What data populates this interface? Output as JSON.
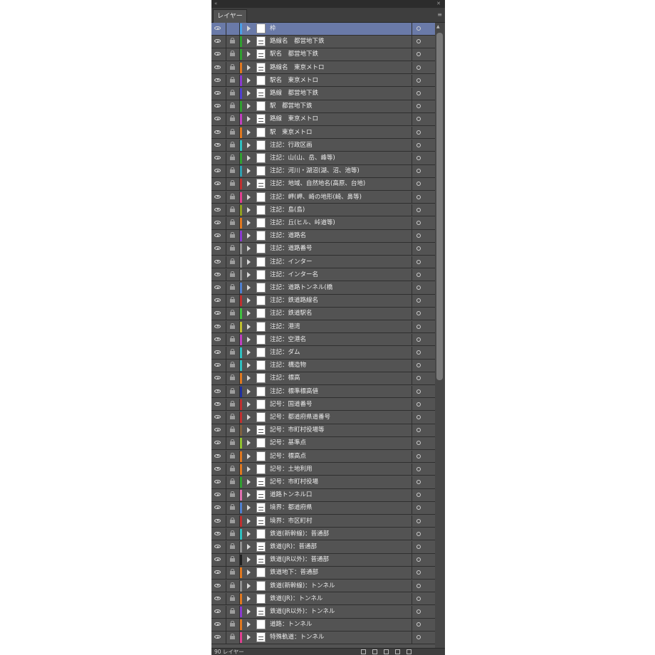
{
  "panel": {
    "tab_label": "レイヤー",
    "menu_icon": "panel-menu-icon",
    "footer_count": "90 レイヤー",
    "colors": {
      "background": "#535353",
      "selected": "#6a7aa8",
      "border": "#2f2f2f"
    }
  },
  "layers": [
    {
      "name": "枠",
      "color": "#4aa0e8",
      "locked": false,
      "selected": true,
      "thumb": "blank"
    },
    {
      "name": "路線名　都営地下鉄",
      "color": "#30a030",
      "locked": true,
      "thumb": "mark"
    },
    {
      "name": "駅名　都営地下鉄",
      "color": "#30a030",
      "locked": true,
      "thumb": "mark"
    },
    {
      "name": "路線名　東京メトロ",
      "color": "#e07820",
      "locked": true,
      "thumb": "mark"
    },
    {
      "name": "駅名　東京メトロ",
      "color": "#8a3ad0",
      "locked": true,
      "thumb": "blank"
    },
    {
      "name": "路線　都営地下鉄",
      "color": "#5040d0",
      "locked": true,
      "thumb": "mark"
    },
    {
      "name": "駅　都営地下鉄",
      "color": "#30a030",
      "locked": true,
      "thumb": "blank"
    },
    {
      "name": "路線　東京メトロ",
      "color": "#c040c0",
      "locked": true,
      "thumb": "mark"
    },
    {
      "name": "駅　東京メトロ",
      "color": "#e07820",
      "locked": true,
      "thumb": "blank"
    },
    {
      "name": "注記：行政区画",
      "color": "#30c0c0",
      "locked": true,
      "thumb": "blank"
    },
    {
      "name": "注記：山(山、岳、峰等)",
      "color": "#30a030",
      "locked": true,
      "thumb": "blank"
    },
    {
      "name": "注記：河川・湖沼(湖、沼、池等)",
      "color": "#30a0b0",
      "locked": true,
      "thumb": "blank"
    },
    {
      "name": "注記：地域、自然地名(高原、台地)",
      "color": "#c03030",
      "locked": true,
      "thumb": "mark"
    },
    {
      "name": "注記：岬(岬、崎の地形(崎、鼻等)",
      "color": "#e04090",
      "locked": true,
      "thumb": "blank"
    },
    {
      "name": "注記：島(島)",
      "color": "#90a020",
      "locked": true,
      "thumb": "blank"
    },
    {
      "name": "注記：丘(ヒル、峠道等)",
      "color": "#e07820",
      "locked": true,
      "thumb": "blank"
    },
    {
      "name": "注記：道路名",
      "color": "#8a3ad0",
      "locked": true,
      "thumb": "blank"
    },
    {
      "name": "注記：道路番号",
      "color": "#909090",
      "locked": true,
      "thumb": "blank"
    },
    {
      "name": "注記：インター",
      "color": "#909090",
      "locked": true,
      "thumb": "blank"
    },
    {
      "name": "注記：インター名",
      "color": "#909090",
      "locked": true,
      "thumb": "blank"
    },
    {
      "name": "注記：道路トンネル(橋",
      "color": "#5080d0",
      "locked": true,
      "thumb": "blank"
    },
    {
      "name": "注記：鉄道路線名",
      "color": "#c03030",
      "locked": true,
      "thumb": "blank"
    },
    {
      "name": "注記：鉄道駅名",
      "color": "#40c040",
      "locked": true,
      "thumb": "blank"
    },
    {
      "name": "注記：港湾",
      "color": "#c0c030",
      "locked": true,
      "thumb": "blank"
    },
    {
      "name": "注記：空港名",
      "color": "#c040c0",
      "locked": true,
      "thumb": "blank"
    },
    {
      "name": "注記：ダム",
      "color": "#30c0c0",
      "locked": true,
      "thumb": "blank"
    },
    {
      "name": "注記：構造物",
      "color": "#30c0c0",
      "locked": true,
      "thumb": "blank"
    },
    {
      "name": "注記：標高",
      "color": "#e07820",
      "locked": true,
      "thumb": "blank"
    },
    {
      "name": "注記：標準標高値",
      "color": "#2030a0",
      "locked": true,
      "thumb": "blank"
    },
    {
      "name": "記号：国道番号",
      "color": "#c03030",
      "locked": true,
      "thumb": "blank"
    },
    {
      "name": "記号：都道府県道番号",
      "color": "#c03030",
      "locked": true,
      "thumb": "blank"
    },
    {
      "name": "記号：市町村役場等",
      "color": "#806040",
      "locked": true,
      "thumb": "mark"
    },
    {
      "name": "記号：基準点",
      "color": "#90c030",
      "locked": true,
      "thumb": "blank"
    },
    {
      "name": "記号：標高点",
      "color": "#e07820",
      "locked": true,
      "thumb": "blank"
    },
    {
      "name": "記号：土地利用",
      "color": "#e07820",
      "locked": true,
      "thumb": "blank"
    },
    {
      "name": "記号：市町村役場",
      "color": "#30a030",
      "locked": true,
      "thumb": "mark"
    },
    {
      "name": "道路トンネル口",
      "color": "#e070b0",
      "locked": true,
      "thumb": "mark"
    },
    {
      "name": "境界：都道府県",
      "color": "#5080d0",
      "locked": true,
      "thumb": "mark"
    },
    {
      "name": "境界：市区町村",
      "color": "#c03030",
      "locked": true,
      "thumb": "mark"
    },
    {
      "name": "鉄道(新幹線)：普通部",
      "color": "#30c0c0",
      "locked": true,
      "thumb": "blank"
    },
    {
      "name": "鉄道(JR)：普通部",
      "color": "#909090",
      "locked": true,
      "thumb": "mark"
    },
    {
      "name": "鉄道(JR以外)：普通部",
      "color": "#202020",
      "locked": true,
      "thumb": "mark"
    },
    {
      "name": "鉄道地下：普通部",
      "color": "#e07820",
      "locked": true,
      "thumb": "blank"
    },
    {
      "name": "鉄道(新幹線)：トンネル",
      "color": "#909090",
      "locked": true,
      "thumb": "blank"
    },
    {
      "name": "鉄道(JR)：トンネル",
      "color": "#e07820",
      "locked": true,
      "thumb": "blank"
    },
    {
      "name": "鉄道(JR以外)：トンネル",
      "color": "#8a3ad0",
      "locked": true,
      "thumb": "mark"
    },
    {
      "name": "道路：トンネル",
      "color": "#e07820",
      "locked": true,
      "thumb": "blank"
    },
    {
      "name": "特殊軌道：トンネル",
      "color": "#e04090",
      "locked": true,
      "thumb": "mark"
    }
  ]
}
